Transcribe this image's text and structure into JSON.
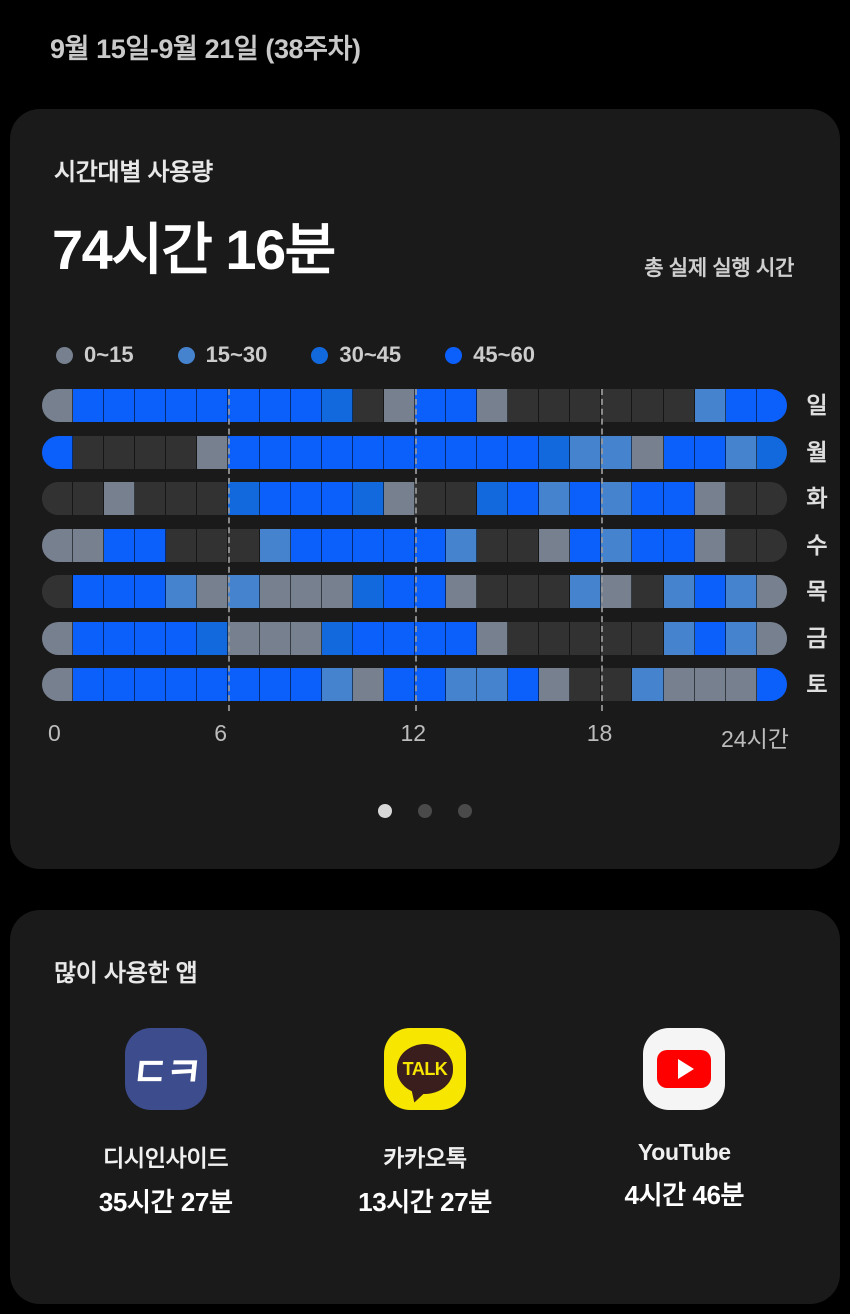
{
  "header": {
    "week_range": "9월 15일-9월 21일 (38주차)"
  },
  "usage_card": {
    "title": "시간대별 사용량",
    "total_time": "74시간 16분",
    "total_label": "총 실제 실행 시간",
    "legend": [
      {
        "label": "0~15",
        "color": "#76808f"
      },
      {
        "label": "15~30",
        "color": "#4583cf"
      },
      {
        "label": "30~45",
        "color": "#1269dd"
      },
      {
        "label": "45~60",
        "color": "#0b5ffb"
      }
    ],
    "pager": {
      "count": 3,
      "active_index": 0
    }
  },
  "chart_data": {
    "type": "heatmap",
    "title": "시간대별 사용량",
    "xlabel": "",
    "ylabel": "",
    "x": [
      0,
      1,
      2,
      3,
      4,
      5,
      6,
      7,
      8,
      9,
      10,
      11,
      12,
      13,
      14,
      15,
      16,
      17,
      18,
      19,
      20,
      21,
      22,
      23
    ],
    "xtick_labels": [
      "0",
      "6",
      "12",
      "18",
      "24시간"
    ],
    "xtick_values": [
      0,
      6,
      12,
      18,
      24
    ],
    "xlim": [
      0,
      24
    ],
    "gridlines_at": [
      6,
      12,
      18
    ],
    "grid": true,
    "legend_position": "top-left",
    "bucket_labels": [
      "0~15",
      "15~30",
      "30~45",
      "45~60"
    ],
    "bucket_colors": [
      "#76808f",
      "#4583cf",
      "#1269dd",
      "#0b5ffb"
    ],
    "empty_color": "#323232",
    "categories": [
      "일",
      "월",
      "화",
      "수",
      "목",
      "금",
      "토"
    ],
    "series": [
      {
        "name": "일",
        "values": [
          0,
          3,
          3,
          3,
          3,
          3,
          3,
          3,
          3,
          2,
          -1,
          0,
          3,
          3,
          0,
          -1,
          -1,
          -1,
          -1,
          -1,
          -1,
          1,
          3,
          3
        ]
      },
      {
        "name": "월",
        "values": [
          3,
          -1,
          -1,
          -1,
          -1,
          0,
          3,
          3,
          3,
          3,
          3,
          3,
          3,
          3,
          3,
          3,
          2,
          1,
          1,
          0,
          3,
          3,
          1,
          2
        ]
      },
      {
        "name": "화",
        "values": [
          -1,
          -1,
          0,
          -1,
          -1,
          -1,
          2,
          3,
          3,
          3,
          2,
          0,
          -1,
          -1,
          2,
          3,
          1,
          3,
          1,
          3,
          3,
          0,
          -1,
          -1
        ]
      },
      {
        "name": "수",
        "values": [
          0,
          0,
          3,
          3,
          -1,
          -1,
          -1,
          1,
          3,
          3,
          3,
          3,
          3,
          1,
          -1,
          -1,
          0,
          3,
          1,
          3,
          3,
          0,
          -1,
          -1
        ]
      },
      {
        "name": "목",
        "values": [
          -1,
          3,
          3,
          3,
          1,
          0,
          1,
          0,
          0,
          0,
          2,
          3,
          3,
          0,
          -1,
          -1,
          -1,
          1,
          0,
          -1,
          1,
          3,
          1,
          0
        ]
      },
      {
        "name": "금",
        "values": [
          0,
          3,
          3,
          3,
          3,
          2,
          0,
          0,
          0,
          2,
          3,
          3,
          3,
          3,
          0,
          -1,
          -1,
          -1,
          -1,
          -1,
          1,
          3,
          1,
          0
        ]
      },
      {
        "name": "토",
        "values": [
          0,
          3,
          3,
          3,
          3,
          3,
          3,
          3,
          3,
          1,
          0,
          3,
          3,
          1,
          1,
          3,
          0,
          -1,
          -1,
          1,
          0,
          0,
          0,
          3
        ]
      }
    ]
  },
  "apps_card": {
    "title": "많이 사용한 앱",
    "apps": [
      {
        "icon": "dcinside-icon",
        "icon_bg": "#3d4c8c",
        "glyph": "ㄷㅋ",
        "name": "디시인사이드",
        "time": "35시간 27분"
      },
      {
        "icon": "kakaotalk-icon",
        "icon_bg": "#f7e600",
        "glyph": "TALK",
        "name": "카카오톡",
        "time": "13시간 27분"
      },
      {
        "icon": "youtube-icon",
        "icon_bg": "#f5f5f5",
        "glyph": "play",
        "name": "YouTube",
        "time": "4시간 46분"
      }
    ]
  }
}
